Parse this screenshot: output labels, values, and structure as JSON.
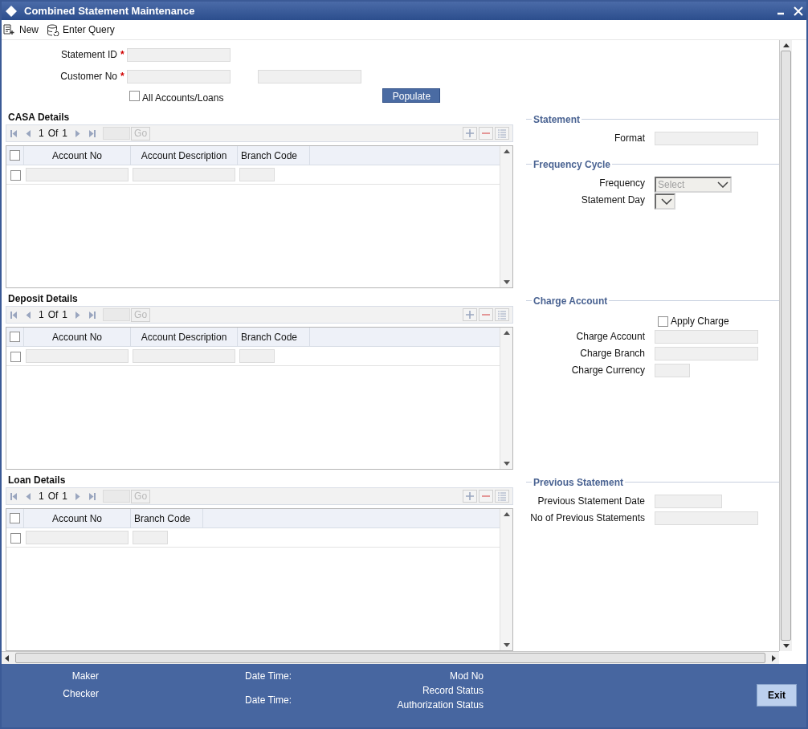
{
  "window": {
    "title": "Combined Statement Maintenance"
  },
  "toolbar": [
    {
      "label": "New",
      "kind": "new"
    },
    {
      "label": "Enter Query",
      "kind": "query"
    }
  ],
  "header_fields": [
    {
      "label": "Statement ID",
      "marker": "*",
      "extra_field": false
    },
    {
      "label": "Customer No",
      "marker": "*",
      "extra_field": true
    }
  ],
  "all_accounts": {
    "label": "All Accounts/Loans",
    "checked": false
  },
  "populate_button": "Populate",
  "grids": [
    {
      "title": "CASA Details",
      "pager": {
        "page": "1",
        "of": "Of",
        "total": "1",
        "go": "Go"
      },
      "header_checked": false,
      "columns": [
        {
          "label": "Account No",
          "kind": "text"
        },
        {
          "label": "Account Description",
          "kind": "text"
        },
        {
          "label": "Branch Code",
          "kind": "short"
        }
      ],
      "rows": [
        {
          "checked": false
        }
      ]
    },
    {
      "title": "Deposit Details",
      "pager": {
        "page": "1",
        "of": "Of",
        "total": "1",
        "go": "Go"
      },
      "header_checked": false,
      "columns": [
        {
          "label": "Account No",
          "kind": "text"
        },
        {
          "label": "Account Description",
          "kind": "text"
        },
        {
          "label": "Branch Code",
          "kind": "short"
        }
      ],
      "rows": [
        {
          "checked": false
        }
      ]
    },
    {
      "title": "Loan Details",
      "pager": {
        "page": "1",
        "of": "Of",
        "total": "1",
        "go": "Go"
      },
      "header_checked": false,
      "columns": [
        {
          "label": "Account No",
          "kind": "text"
        },
        {
          "label": "Branch Code",
          "kind": "short"
        }
      ],
      "rows": [
        {
          "checked": false
        }
      ]
    }
  ],
  "side_panel": [
    [
      {
        "legend": "Statement",
        "fields": [
          {
            "label": "Format",
            "kind": "text"
          }
        ]
      },
      {
        "legend": "Frequency Cycle",
        "fields": [
          {
            "label": "Frequency",
            "kind": "select",
            "placeholder": "Select"
          },
          {
            "label": "Statement Day",
            "kind": "dayselect"
          }
        ]
      }
    ],
    [
      {
        "legend": "Charge Account",
        "fields": [
          {
            "label": "Apply Charge",
            "kind": "checkbox",
            "checked": false
          },
          {
            "label": "Charge Account",
            "kind": "text"
          },
          {
            "label": "Charge Branch",
            "kind": "text"
          },
          {
            "label": "Charge Currency",
            "kind": "code"
          }
        ]
      }
    ],
    [
      {
        "legend": "Previous Statement",
        "fields": [
          {
            "label": "Previous Statement Date",
            "kind": "date"
          },
          {
            "label": "No of Previous Statements",
            "kind": "text"
          }
        ]
      }
    ]
  ],
  "footer": {
    "columns": [
      [
        "Maker",
        "Checker"
      ],
      [
        "Date Time:",
        "Date Time:"
      ],
      [
        "Mod No",
        "Record Status",
        "Authorization Status"
      ]
    ],
    "exit_button": "Exit"
  }
}
